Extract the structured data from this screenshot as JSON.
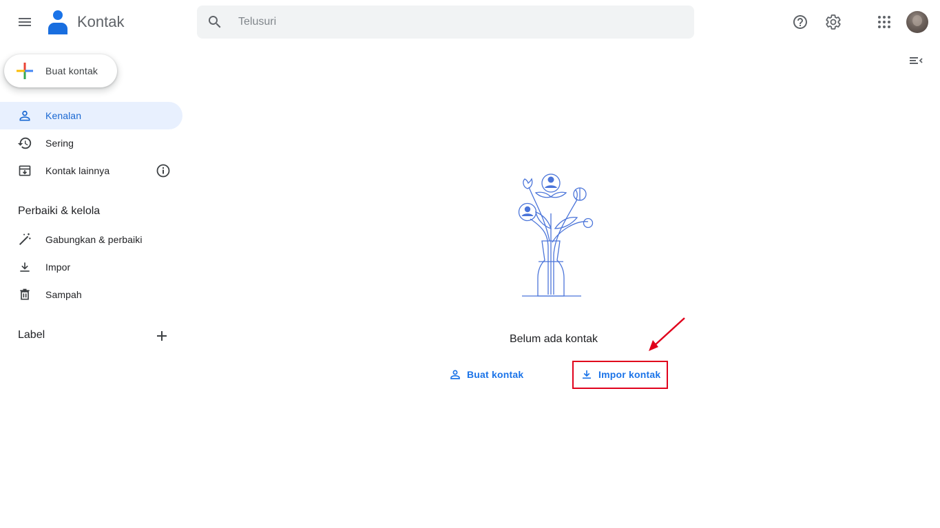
{
  "header": {
    "app_title": "Kontak",
    "search_placeholder": "Telusuri",
    "icons": [
      "menu-icon",
      "contacts-logo",
      "search-icon",
      "help-icon",
      "gear-icon",
      "apps-grid-icon",
      "avatar",
      "side-panel-toggle-icon"
    ]
  },
  "sidebar": {
    "create_label": "Buat kontak",
    "nav": [
      {
        "label": "Kenalan",
        "icon": "person-icon",
        "active": true
      },
      {
        "label": "Sering",
        "icon": "history-icon"
      },
      {
        "label": "Kontak lainnya",
        "icon": "archive-download-icon"
      }
    ],
    "manage_title": "Perbaiki & kelola",
    "manage": [
      {
        "label": "Gabungkan & perbaiki",
        "icon": "magic-wand-icon"
      },
      {
        "label": "Impor",
        "icon": "download-icon"
      },
      {
        "label": "Sampah",
        "icon": "trash-icon"
      }
    ],
    "label_title": "Label"
  },
  "main": {
    "empty_text": "Belum ada kontak",
    "create_action": "Buat kontak",
    "import_action": "Impor kontak"
  },
  "colors": {
    "accent": "#1a73e8",
    "active_bg": "#e8f0fe",
    "highlight": "#e0001b"
  }
}
